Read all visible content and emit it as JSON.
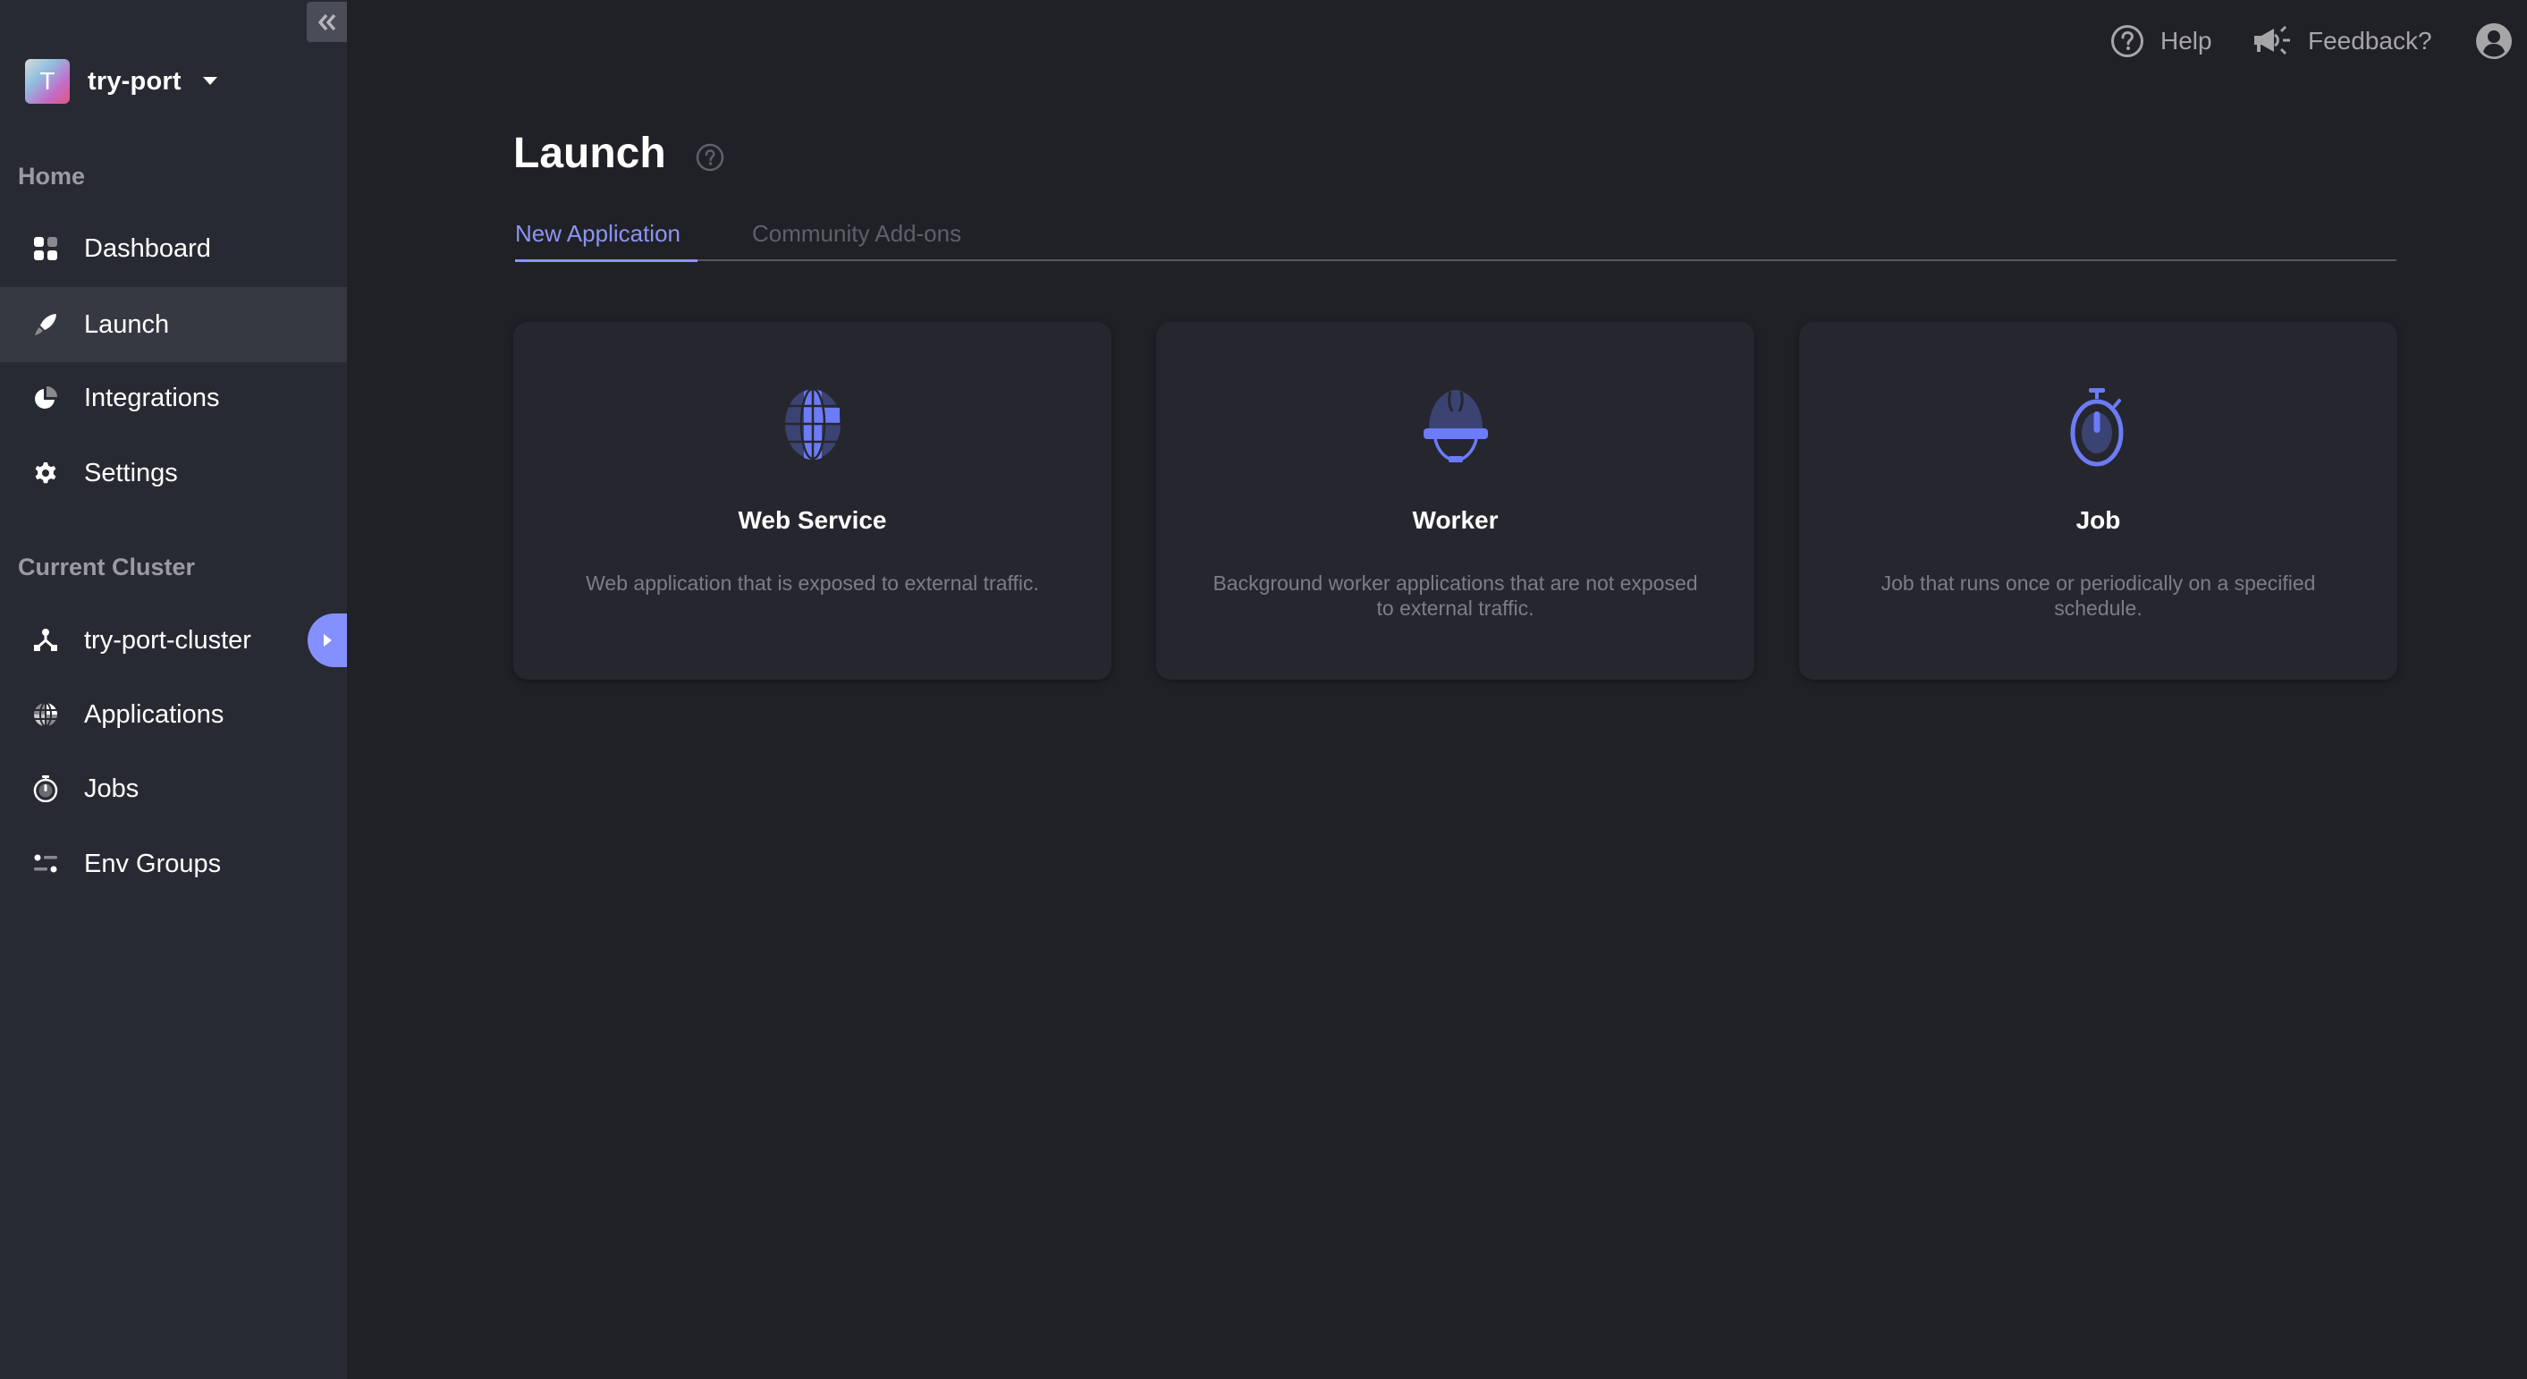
{
  "sidebar": {
    "collapse_icon": "double-chevron-left-icon",
    "workspace": {
      "avatar_letter": "T",
      "name": "try-port"
    },
    "home_label": "Home",
    "home_items": [
      {
        "label": "Dashboard",
        "icon": "dashboard-grid-icon",
        "active": false
      },
      {
        "label": "Launch",
        "icon": "rocket-icon",
        "active": true
      },
      {
        "label": "Integrations",
        "icon": "pie-chart-icon",
        "active": false
      },
      {
        "label": "Settings",
        "icon": "gear-icon",
        "active": false
      }
    ],
    "cluster_label": "Current Cluster",
    "cluster_items": [
      {
        "label": "try-port-cluster",
        "icon": "cluster-nodes-icon"
      },
      {
        "label": "Applications",
        "icon": "globe-icon"
      },
      {
        "label": "Jobs",
        "icon": "stopwatch-icon"
      },
      {
        "label": "Env Groups",
        "icon": "env-groups-icon"
      }
    ]
  },
  "header": {
    "help_label": "Help",
    "feedback_label": "Feedback?",
    "user_icon": "user-circle-icon"
  },
  "main": {
    "title": "Launch",
    "tabs": [
      {
        "label": "New Application",
        "active": true
      },
      {
        "label": "Community Add-ons",
        "active": false
      }
    ],
    "cards": [
      {
        "title": "Web Service",
        "description": "Web application that is exposed to external traffic.",
        "icon": "globe-icon"
      },
      {
        "title": "Worker",
        "description": "Background worker applications that are not exposed to external traffic.",
        "icon": "hard-hat-icon"
      },
      {
        "title": "Job",
        "description": "Job that runs once or periodically on a specified schedule.",
        "icon": "stopwatch-icon"
      }
    ]
  },
  "colors": {
    "accent": "#8590ff",
    "icon_primary": "#6c7bf7",
    "icon_secondary": "#3b4372",
    "sidebar_bg": "#282a33",
    "main_bg": "#202126",
    "card_bg": "#26272e"
  }
}
